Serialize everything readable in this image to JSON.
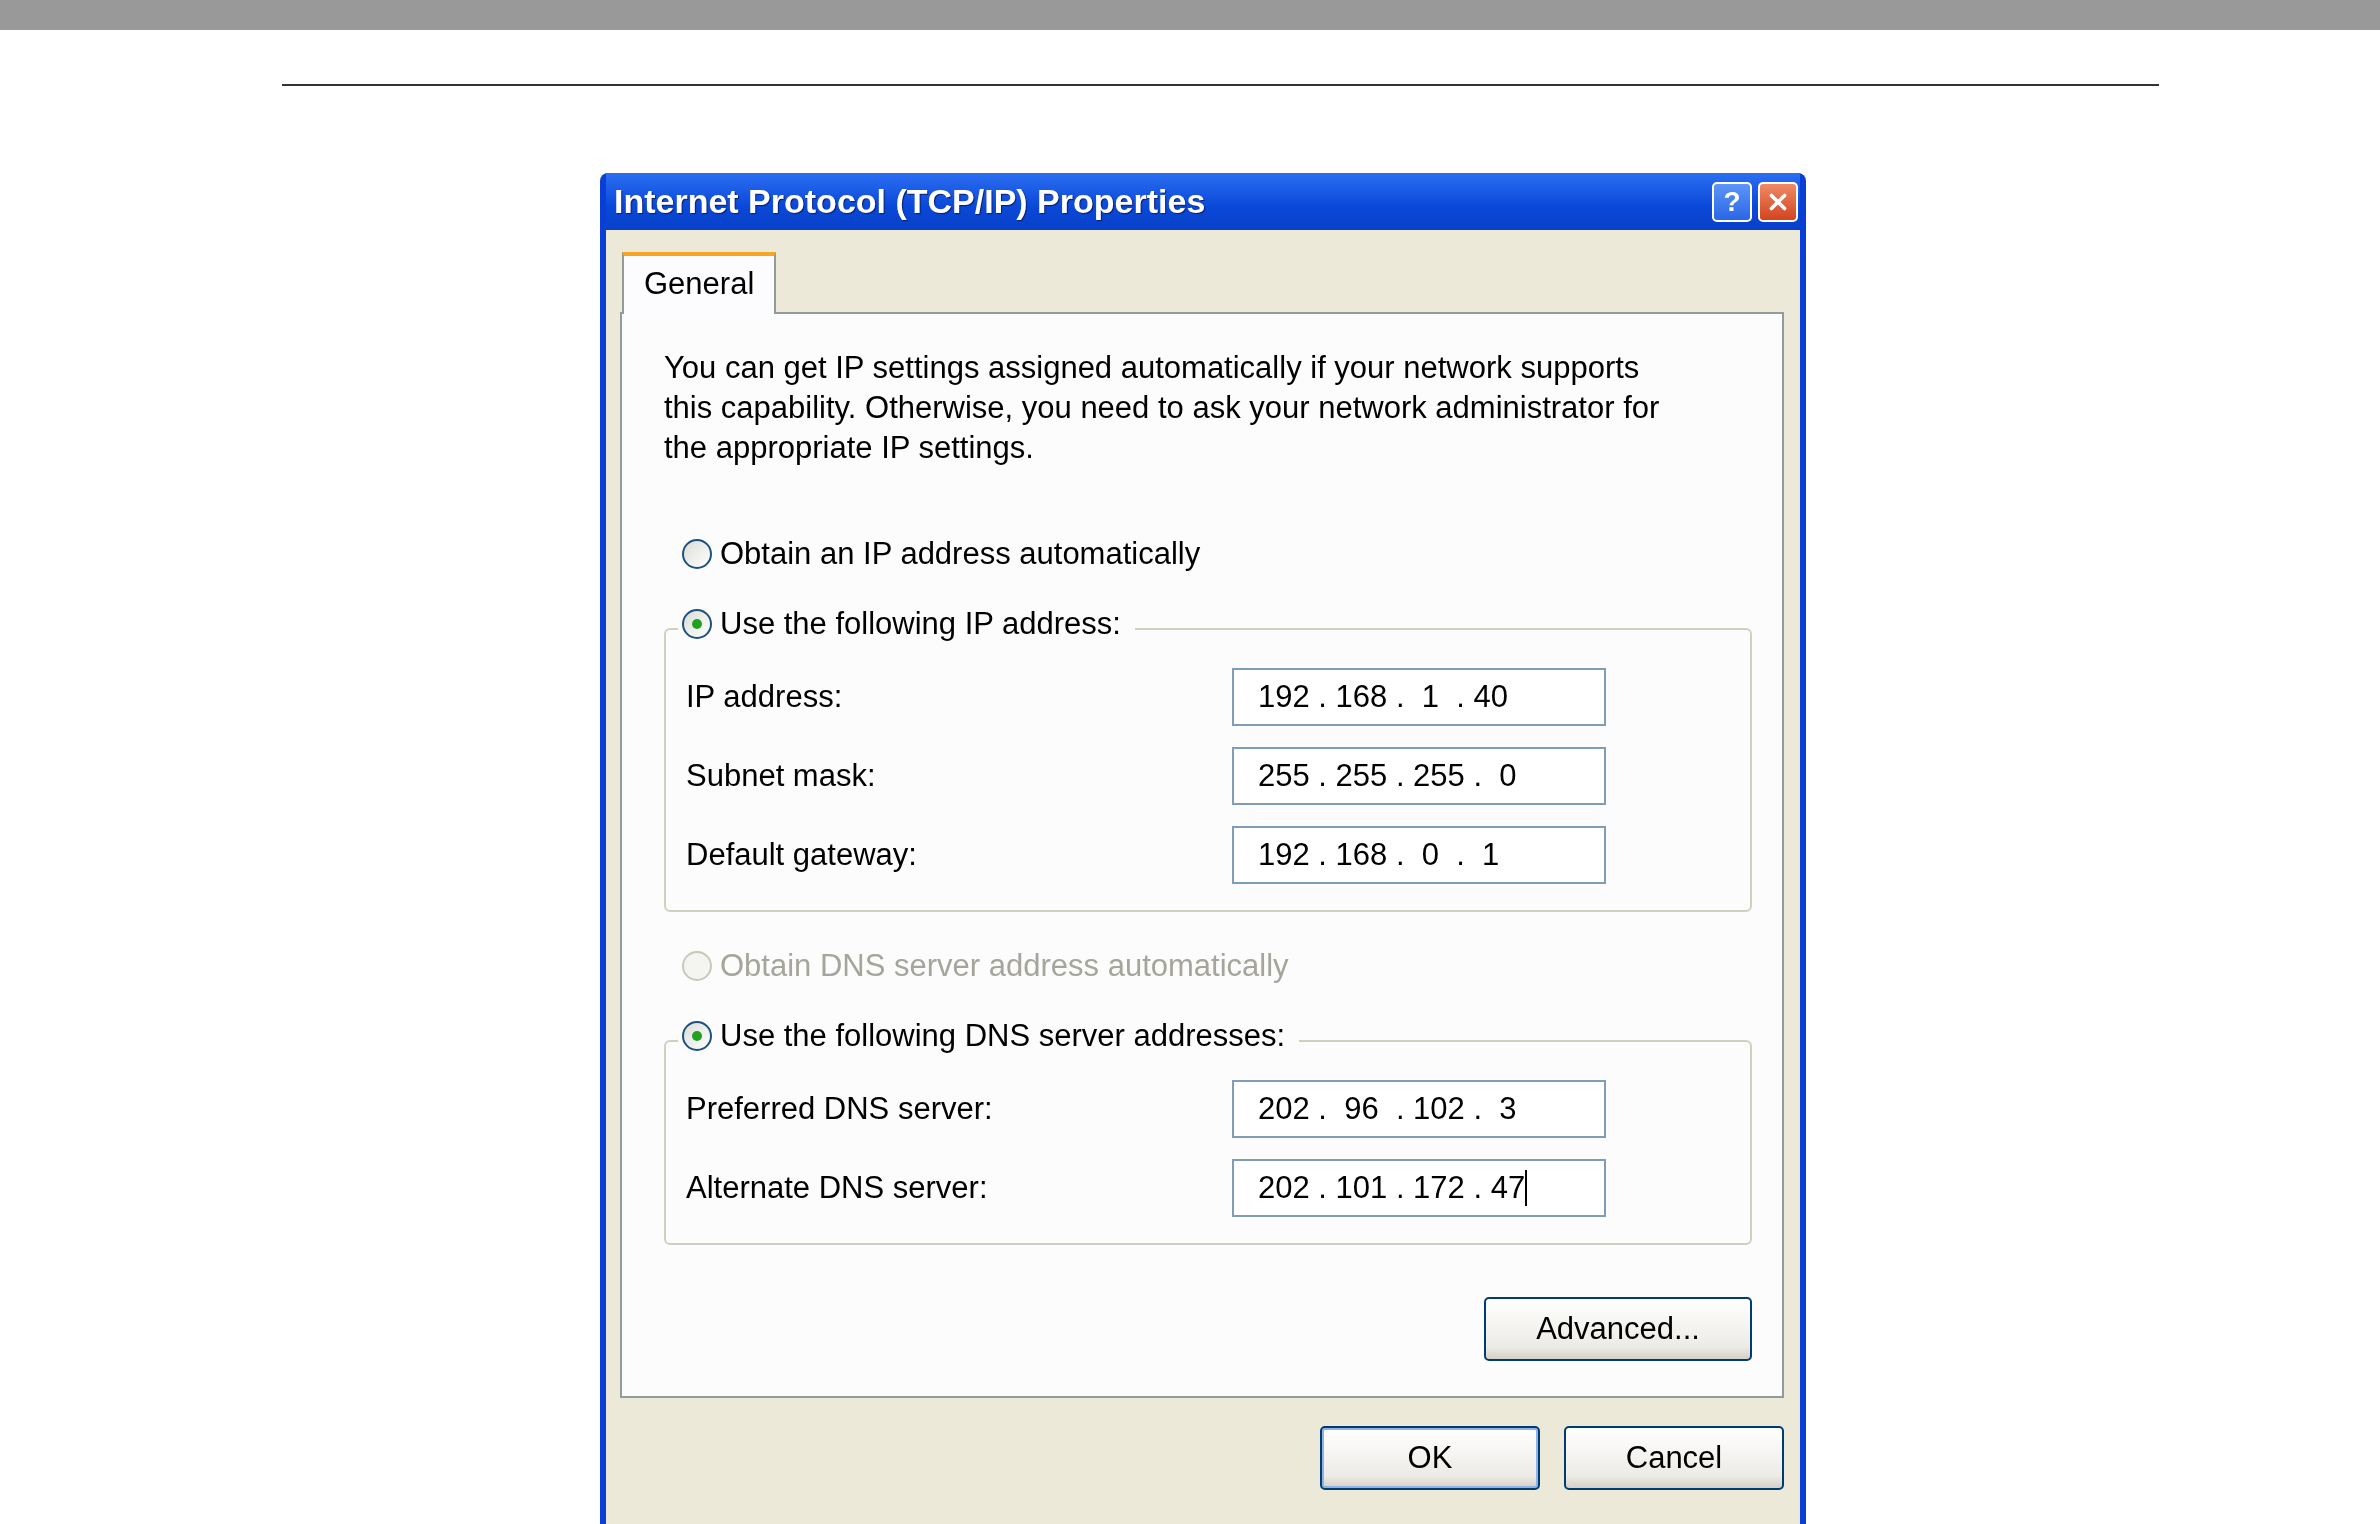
{
  "window": {
    "title": "Internet Protocol (TCP/IP) Properties",
    "help_button": "?"
  },
  "tabs": [
    {
      "label": "General",
      "selected": true
    }
  ],
  "intro": "You can get IP settings assigned automatically if your network supports this capability. Otherwise, you need to ask your network administrator for the appropriate IP settings.",
  "ip_options": [
    {
      "label": "Obtain an IP address automatically",
      "selected": false,
      "disabled": false
    },
    {
      "label": "Use the following IP address:",
      "selected": true,
      "disabled": false
    }
  ],
  "ip_fields": [
    {
      "label": "IP address:",
      "value": "192 . 168 .  1  . 40",
      "focused": false
    },
    {
      "label": "Subnet mask:",
      "value": "255 . 255 . 255 .  0",
      "focused": false
    },
    {
      "label": "Default gateway:",
      "value": "192 . 168 .  0  .  1",
      "focused": false
    }
  ],
  "dns_options": [
    {
      "label": "Obtain DNS server address automatically",
      "selected": false,
      "disabled": true
    },
    {
      "label": "Use the following DNS server addresses:",
      "selected": true,
      "disabled": false
    }
  ],
  "dns_fields": [
    {
      "label": "Preferred DNS server:",
      "value": "202 .  96  . 102 .  3",
      "focused": false
    },
    {
      "label": "Alternate DNS server:",
      "value": "202 . 101 . 172 . 47",
      "focused": true
    }
  ],
  "advanced_button": "Advanced...",
  "buttons": [
    {
      "label": "OK",
      "default": true
    },
    {
      "label": "Cancel",
      "default": false
    }
  ]
}
